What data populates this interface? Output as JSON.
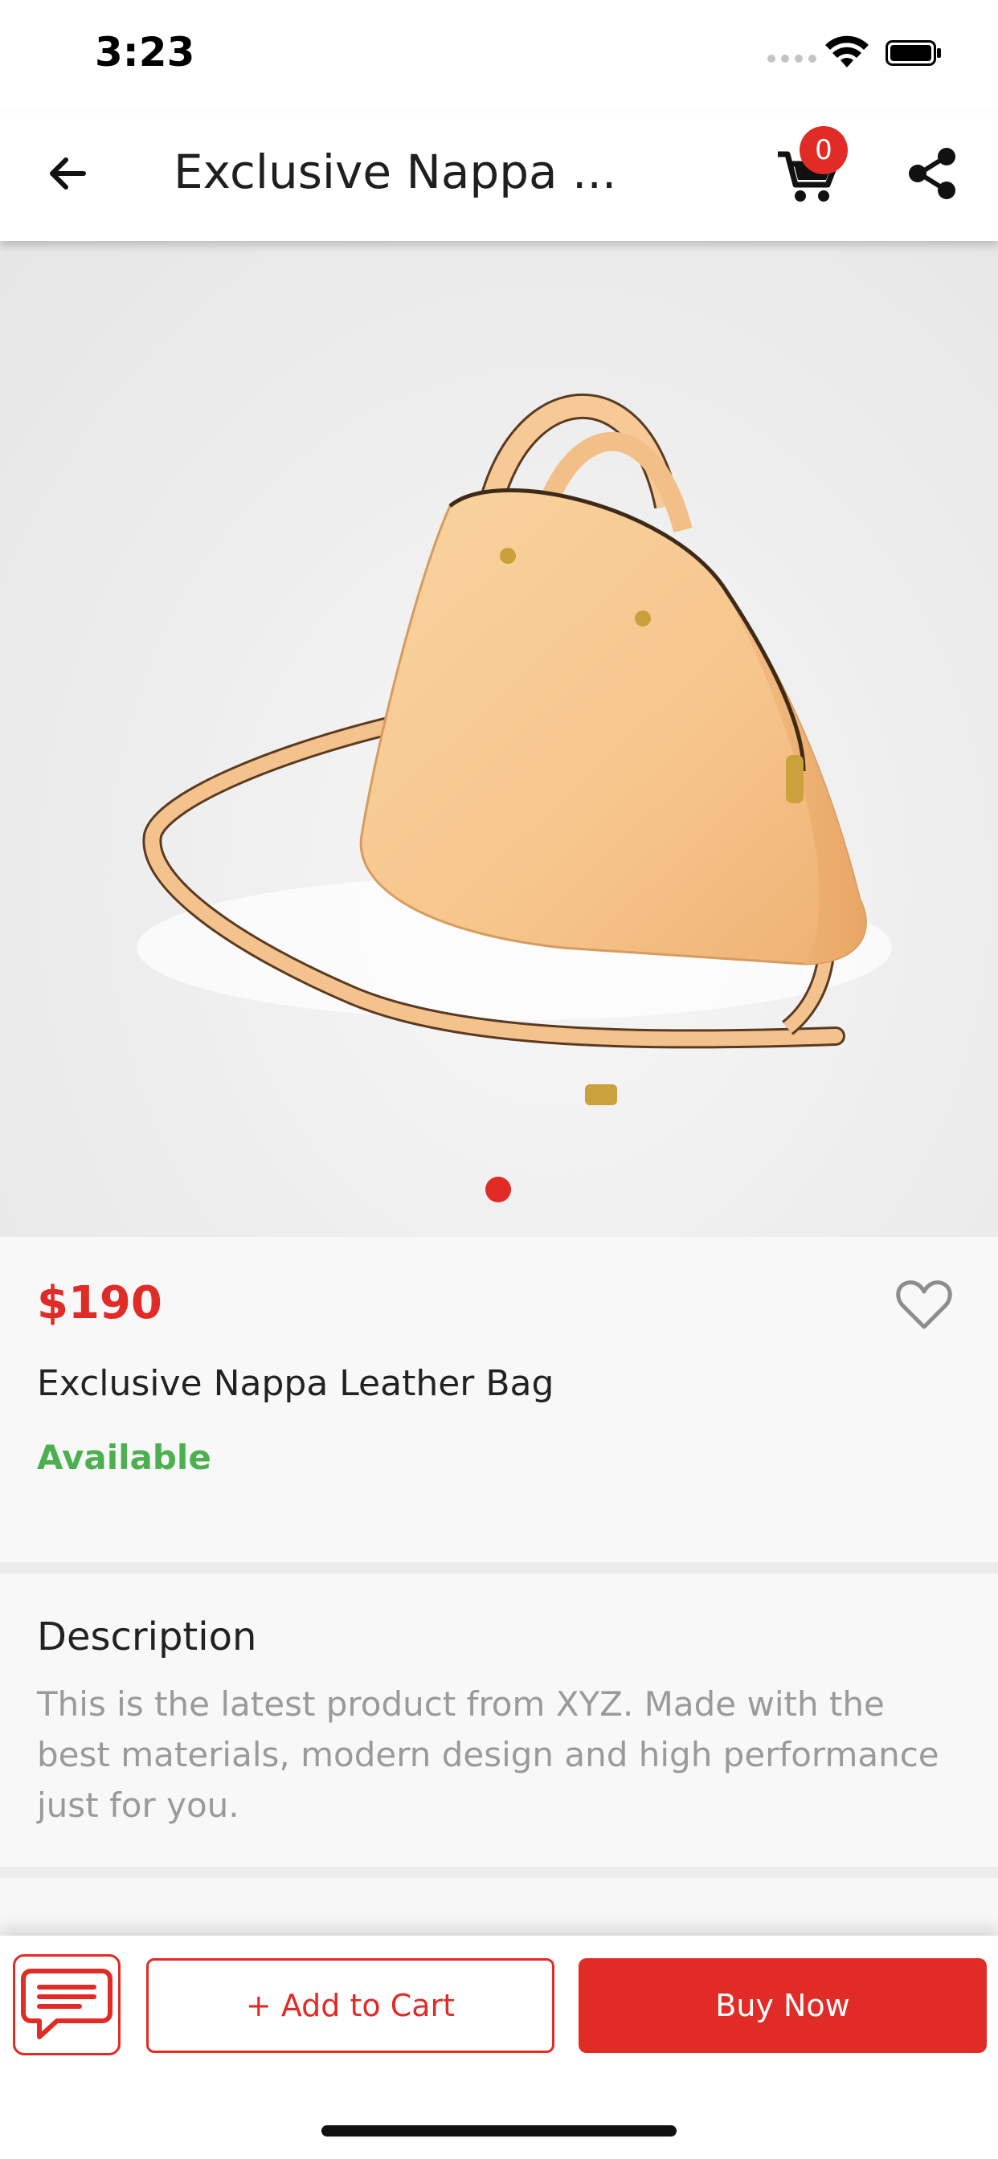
{
  "status_bar": {
    "time": "3:23"
  },
  "header": {
    "title": "Exclusive Nappa ...",
    "cart_count": "0",
    "icons": {
      "back": "arrow-left-icon",
      "cart": "cart-icon",
      "share": "share-icon"
    }
  },
  "gallery": {
    "image": "tan leather handbag with shoulder strap",
    "page_indicator": {
      "current": 1,
      "total": 1
    }
  },
  "product": {
    "price": "$190",
    "name": "Exclusive Nappa Leather Bag",
    "availability": "Available",
    "wishlist_icon": "heart-icon"
  },
  "description": {
    "title": "Description",
    "text": "This is the latest product from XYZ. Made with the best materials, modern design and high performance just for you."
  },
  "actions": {
    "chat_icon": "chat-icon",
    "add_to_cart": "+ Add to Cart",
    "buy_now": "Buy Now"
  },
  "colors": {
    "accent": "#e02b27",
    "available": "#4caf50",
    "muted_text": "#9a9a9a"
  }
}
